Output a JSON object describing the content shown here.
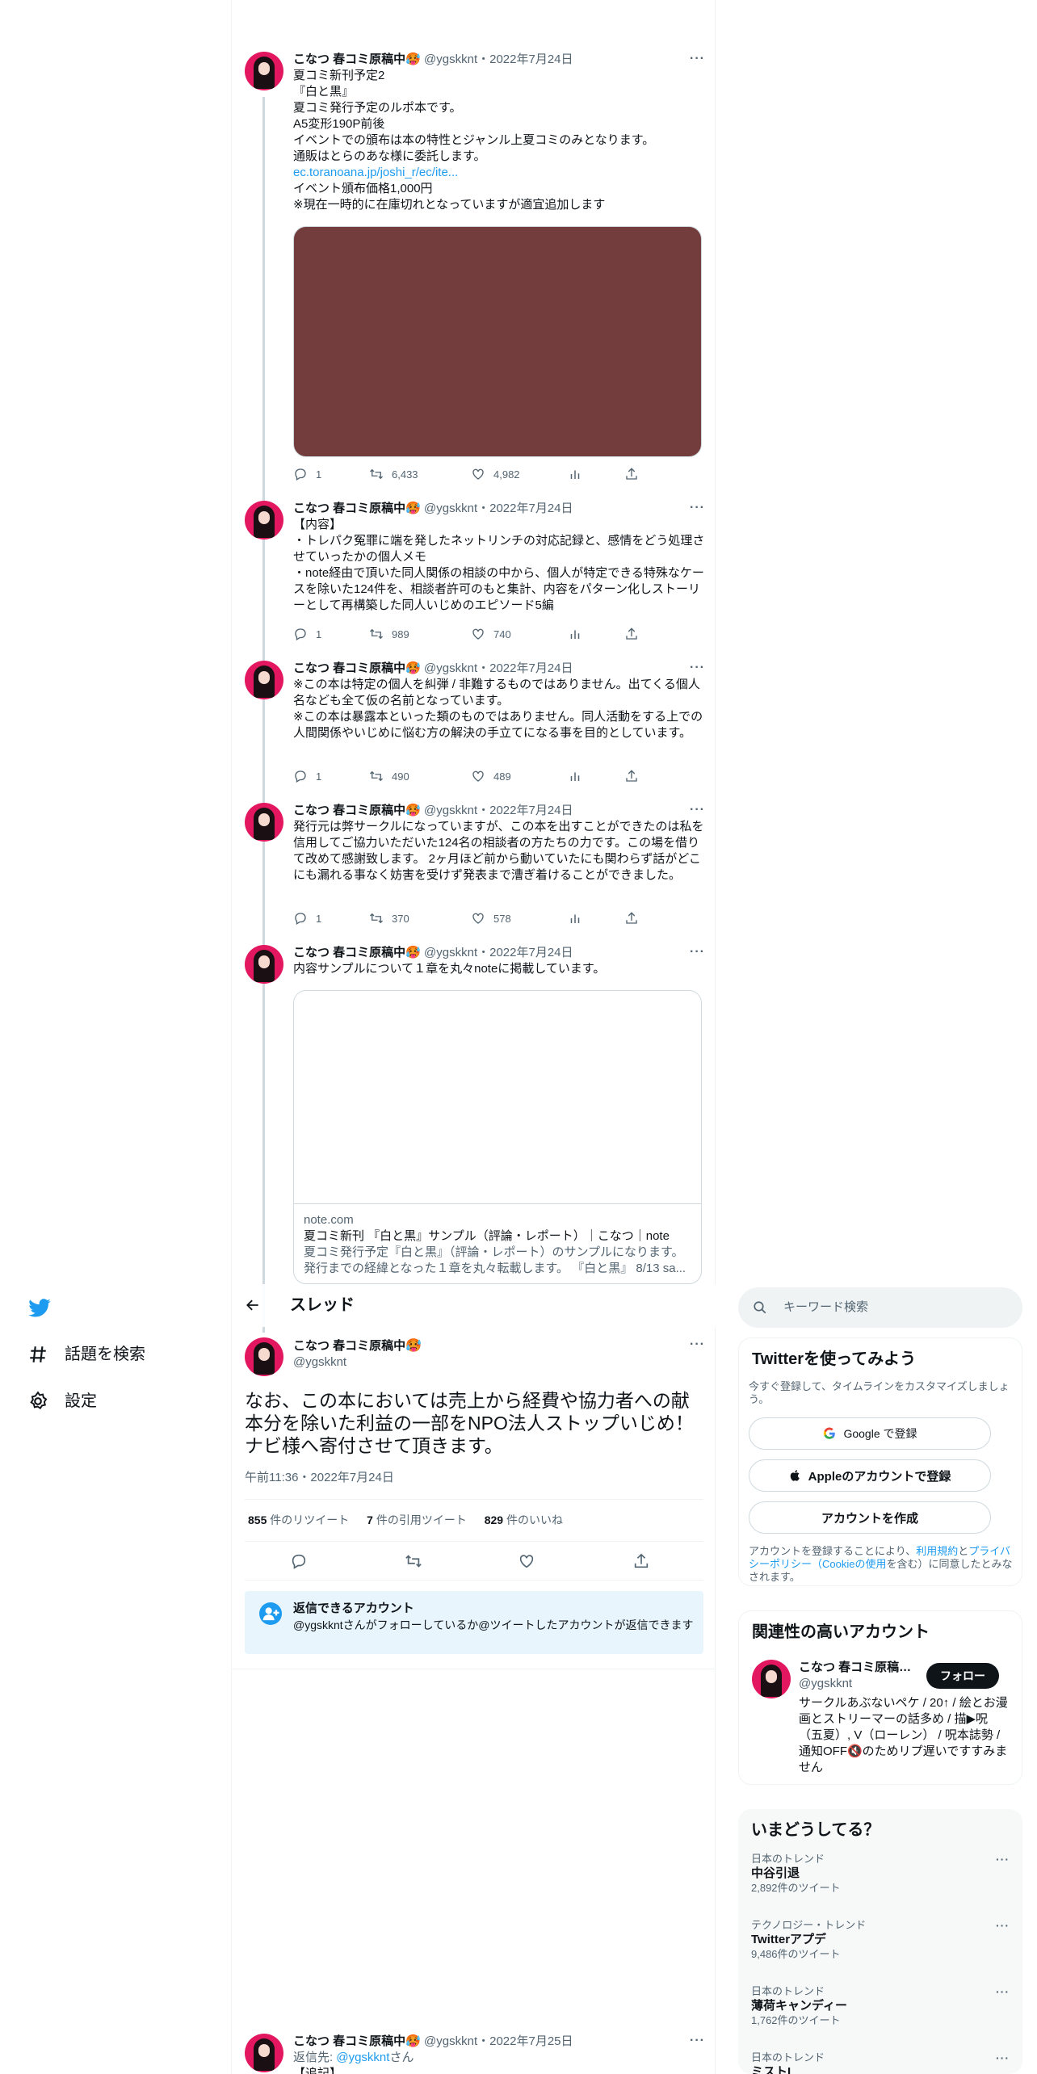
{
  "author": {
    "name": "こなつ 春コミ原稿中",
    "handle": "@ygskknt",
    "name_emoji": "🥵"
  },
  "thread_tweets": [
    {
      "name": "こなつ 春コミ原稿中",
      "handle_date": "@ygskknt・2022年7月24日",
      "text": "夏コミ新刊予定2\n『白と黒』\n夏コミ発行予定のルポ本です。\nA5変形190P前後\nイベントでの頒布は本の特性とジャンル上夏コミのみとなります。\n通販はとらのあな様に委託します。",
      "link": "ec.toranoana.jp/joshi_r/ec/ite...",
      "text2": "イベント頒布価格1,000円\n※現在一時的に在庫切れとなっていますが適宜追加します",
      "replies": "1",
      "retweets": "6,433",
      "likes": "4,982"
    },
    {
      "name": "こなつ 春コミ原稿中",
      "handle_date": "@ygskknt・2022年7月24日",
      "text": "【内容】\n・トレパク冤罪に端を発したネットリンチの対応記録と、感情をどう処理させていったかの個人メモ\n・note経由で頂いた同人関係の相談の中から、個人が特定できる特殊なケースを除いた124件を、相談者許可のもと集計、内容をパターン化しストーリーとして再構築した同人いじめのエピソード5編",
      "replies": "1",
      "retweets": "989",
      "likes": "740"
    },
    {
      "name": "こなつ 春コミ原稿中",
      "handle_date": "@ygskknt・2022年7月24日",
      "text": "※この本は特定の個人を糾弾 / 非難するものではありません。出てくる個人名なども全て仮の名前となっています。\n※この本は暴露本といった類のものではありません。同人活動をする上での人間関係やいじめに悩む方の解決の手立てになる事を目的としています。",
      "replies": "1",
      "retweets": "490",
      "likes": "489"
    },
    {
      "name": "こなつ 春コミ原稿中",
      "handle_date": "@ygskknt・2022年7月24日",
      "text": "発行元は弊サークルになっていますが、この本を出すことができたのは私を信用してご協力いただいた124名の相談者の方たちの力です。この場を借りて改めて感謝致します。 2ヶ月ほど前から動いていたにも関わらず話がどこにも漏れる事なく妨害を受けず発表まで漕ぎ着けることができました。",
      "replies": "1",
      "retweets": "370",
      "likes": "578"
    },
    {
      "name": "こなつ 春コミ原稿中",
      "handle_date": "@ygskknt・2022年7月24日",
      "text": "内容サンプルについて１章を丸々noteに掲載しています。",
      "card": {
        "domain": "note.com",
        "title": "夏コミ新刊 『白と黒』サンプル（評論・レポート）｜こなつ｜note",
        "desc": "夏コミ発行予定『白と黒』（評論・レポート）のサンプルになります。発行までの経緯となった１章を丸々転載します。 『白と黒』 8/13 sa..."
      }
    }
  ],
  "header": {
    "title": "スレッド"
  },
  "focus_tweet": {
    "name": "こなつ 春コミ原稿中",
    "handle": "@ygskknt",
    "text": "なお、この本においては売上から経費や協力者への献本分を除いた利益の一部をNPO法人ストップいじめ！ナビ様へ寄付させて頂きます。",
    "time": "午前11:36・2022年7月24日",
    "retweets": "855",
    "retweets_label": " 件のリツイート",
    "quotes": "7",
    "quotes_label": " 件の引用ツイート",
    "likes": "829",
    "likes_label": " 件のいいね"
  },
  "reply_notice": {
    "title": "返信できるアカウント",
    "desc": "@ygskkntさんがフォローしているか@ツイートしたアカウントが返信できます"
  },
  "last_tweet": {
    "name": "こなつ 春コミ原稿中",
    "handle_date": "@ygskknt・2022年7月25日",
    "reply_to_label": "返信先: ",
    "reply_to_handle": "@ygskknt",
    "reply_to_suffix": "さん",
    "text": "【追記】"
  },
  "left_nav": {
    "explore": "話題を検索",
    "settings": "設定"
  },
  "search": {
    "placeholder": "キーワード検索"
  },
  "signup": {
    "title": "Twitterを使ってみよう",
    "desc": "今すぐ登録して、タイムラインをカスタマイズしましょう。",
    "google": "Google で登録",
    "apple": "Appleのアカウントで登録",
    "create": "アカウントを作成",
    "terms_1": "アカウントを登録することにより、",
    "terms_link1": "利用規約",
    "terms_2": "と",
    "terms_link2": "プライバシーポリシー（Cookieの使用",
    "terms_3": "を含む）に同意したとみなされます。"
  },
  "related": {
    "title": "関連性の高いアカウント",
    "name": "こなつ 春コミ原稿中...",
    "handle": "@ygskknt",
    "follow": "フォロー",
    "bio": "サークルあぶないペケ / 20↑ / 絵とお漫画とストリーマーの話多め / 描▶呪（五夏）, V（ローレン） / 呪本誌勢 / 通知OFF🔇のためリプ遅いですすみません"
  },
  "trends": {
    "title": "いまどうしてる？",
    "items": [
      {
        "category": "日本のトレンド",
        "name": "中谷引退",
        "count": "2,892件のツイート"
      },
      {
        "category": "テクノロジー・トレンド",
        "name": "Twitterアプデ",
        "count": "9,486件のツイート"
      },
      {
        "category": "日本のトレンド",
        "name": "薄荷キャンディー",
        "count": "1,762件のツイート"
      },
      {
        "category": "日本のトレンド",
        "name": "ミストL",
        "count": ""
      }
    ]
  },
  "colors": {
    "accent": "#1d9bf0",
    "media": "#733c3d",
    "avatar": "#e2175f"
  }
}
